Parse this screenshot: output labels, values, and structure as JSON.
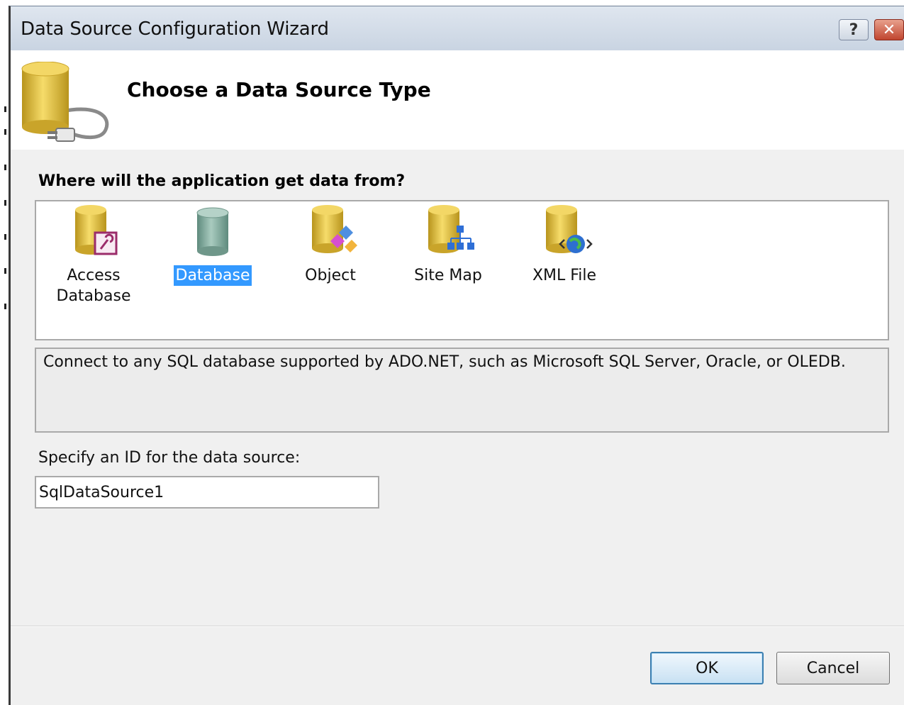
{
  "window": {
    "title": "Data Source Configuration Wizard",
    "help_label": "?",
    "close_label": "✕"
  },
  "header": {
    "title": "Choose a Data Source Type",
    "icon": "database-plug-icon"
  },
  "prompt": "Where will the application get data from?",
  "data_sources": {
    "selected": "Database",
    "items": [
      {
        "label": "Access\nDatabase",
        "icon": "access-database-icon"
      },
      {
        "label": "Database",
        "icon": "database-icon"
      },
      {
        "label": "Object",
        "icon": "object-icon"
      },
      {
        "label": "Site Map",
        "icon": "site-map-icon"
      },
      {
        "label": "XML File",
        "icon": "xml-file-icon"
      }
    ]
  },
  "description": "Connect to any SQL database supported by ADO.NET, such as Microsoft SQL Server, Oracle, or OLEDB.",
  "id_field": {
    "label": "Specify an ID for the data source:",
    "value": "SqlDataSource1"
  },
  "buttons": {
    "ok": "OK",
    "cancel": "Cancel"
  },
  "colors": {
    "selection": "#3399ff",
    "title_bar": "#c9d4e2",
    "cylinder_gold": "#e8c23a",
    "cylinder_teal": "#86aea2"
  }
}
